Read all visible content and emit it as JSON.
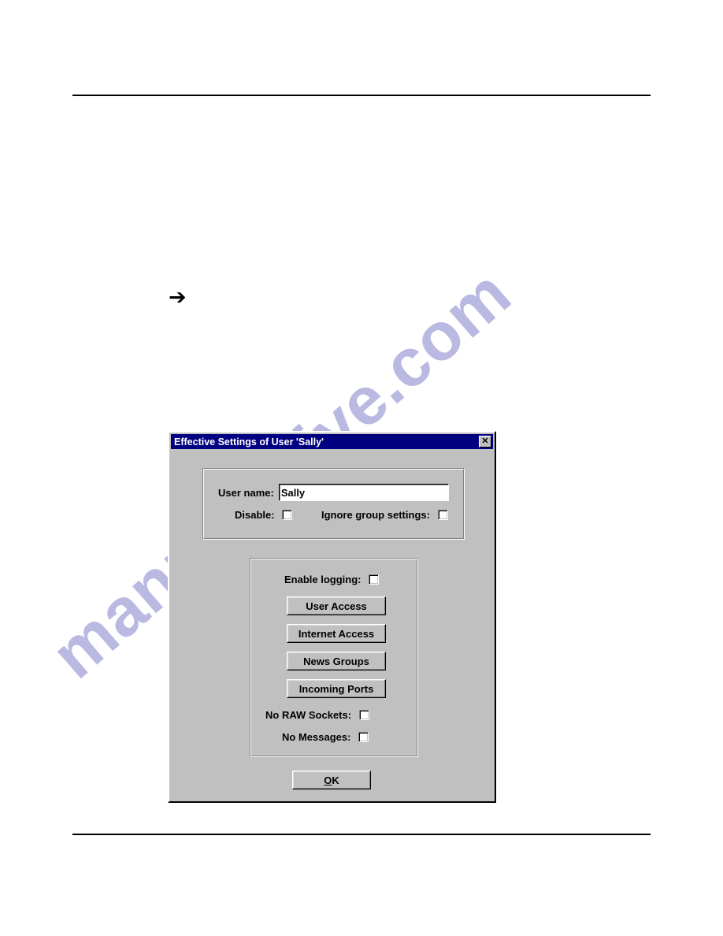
{
  "page": {
    "arrow_marker": "➔",
    "watermark_text": "manualshive.com",
    "watermark_color": "#b9b9e2"
  },
  "dialog": {
    "title": "Effective Settings of User 'Sally'",
    "title_bar_color": "#000080",
    "face_color": "#c0c0c0",
    "close_label": "✕",
    "identity_group": {
      "username_label": "User name:",
      "username_value": "Sally",
      "username_placeholder": "",
      "disable_label": "Disable:",
      "disable_checked": false,
      "ignore_group_settings_label": "Ignore group settings:",
      "ignore_group_settings_checked": false
    },
    "permissions_group": {
      "enable_logging_label": "Enable logging:",
      "enable_logging_checked": false,
      "buttons": [
        {
          "label": "User Access"
        },
        {
          "label": "Internet Access"
        },
        {
          "label": "News Groups"
        },
        {
          "label": "Incoming Ports"
        }
      ],
      "no_raw_sockets_label": "No RAW Sockets:",
      "no_raw_sockets_checked": false,
      "no_messages_label": "No Messages:",
      "no_messages_checked": false
    },
    "ok_button": {
      "accel": "O",
      "rest": "K"
    }
  }
}
